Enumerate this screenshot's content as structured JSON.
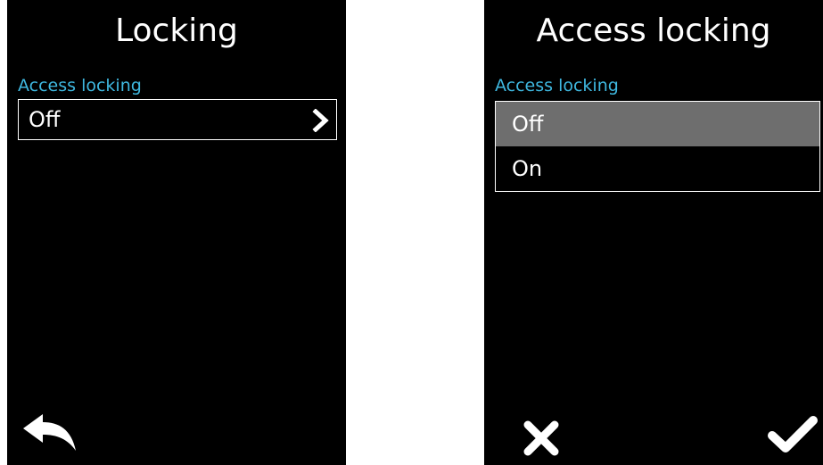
{
  "colors": {
    "screen_background": "#000000",
    "text": "#ffffff",
    "label_accent": "#3fb8e0",
    "selected_row": "#6e6e6e"
  },
  "left_screen": {
    "title": "Locking",
    "field_label": "Access locking",
    "field_value": "Off",
    "chevron_icon": "chevron-right-icon",
    "back_icon": "back-arrow-icon"
  },
  "right_screen": {
    "title": "Access locking",
    "field_label": "Access locking",
    "options": [
      {
        "label": "Off",
        "selected": true
      },
      {
        "label": "On",
        "selected": false
      }
    ],
    "cancel_icon": "close-icon",
    "confirm_icon": "checkmark-icon"
  }
}
